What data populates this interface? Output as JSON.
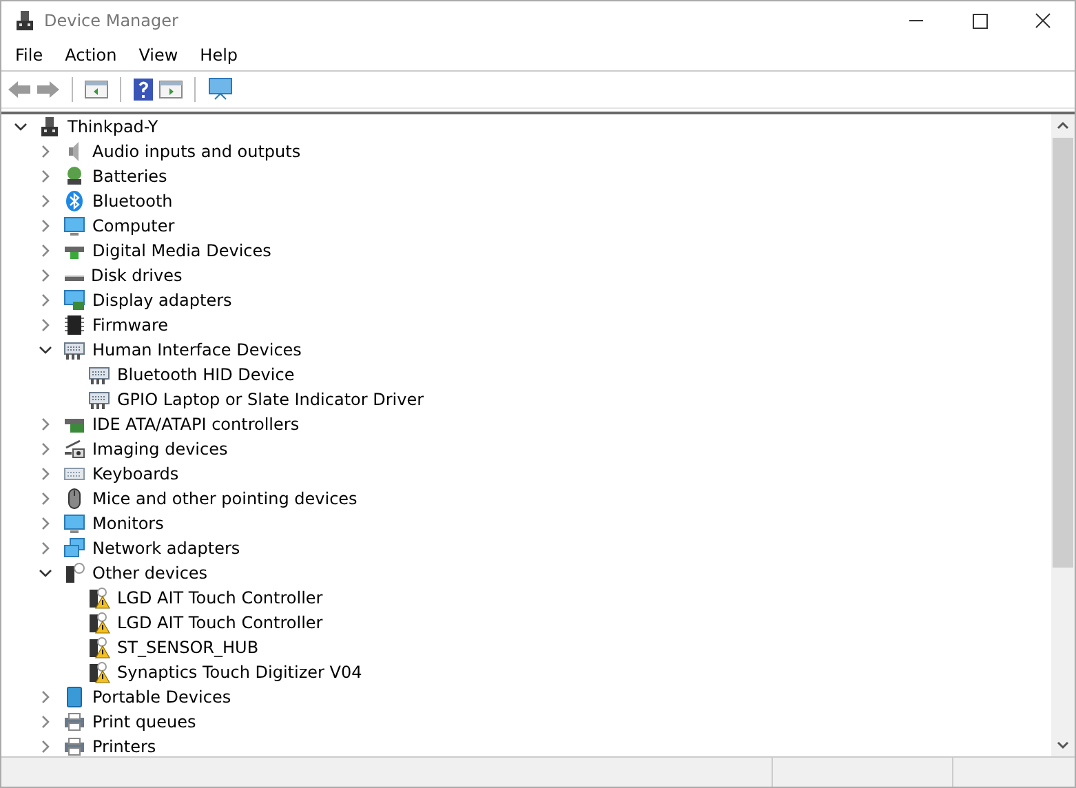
{
  "window": {
    "title": "Device Manager"
  },
  "menu": [
    "File",
    "Action",
    "View",
    "Help"
  ],
  "tree": {
    "label": "Thinkpad-Y",
    "expanded": true,
    "children": [
      {
        "label": "Audio inputs and outputs",
        "expanded": false
      },
      {
        "label": "Batteries",
        "expanded": false
      },
      {
        "label": "Bluetooth",
        "expanded": false
      },
      {
        "label": "Computer",
        "expanded": false
      },
      {
        "label": "Digital Media Devices",
        "expanded": false
      },
      {
        "label": "Disk drives",
        "expanded": false
      },
      {
        "label": "Display adapters",
        "expanded": false
      },
      {
        "label": "Firmware",
        "expanded": false
      },
      {
        "label": "Human Interface Devices",
        "expanded": true,
        "children": [
          {
            "label": "Bluetooth HID Device",
            "warning": false
          },
          {
            "label": "GPIO Laptop or Slate Indicator Driver",
            "warning": false
          }
        ]
      },
      {
        "label": "IDE ATA/ATAPI controllers",
        "expanded": false
      },
      {
        "label": "Imaging devices",
        "expanded": false
      },
      {
        "label": "Keyboards",
        "expanded": false
      },
      {
        "label": "Mice and other pointing devices",
        "expanded": false
      },
      {
        "label": "Monitors",
        "expanded": false
      },
      {
        "label": "Network adapters",
        "expanded": false
      },
      {
        "label": "Other devices",
        "expanded": true,
        "children": [
          {
            "label": "LGD AIT Touch Controller",
            "warning": true
          },
          {
            "label": "LGD AIT Touch Controller",
            "warning": true
          },
          {
            "label": "ST_SENSOR_HUB",
            "warning": true
          },
          {
            "label": "Synaptics Touch Digitizer V04",
            "warning": true
          }
        ]
      },
      {
        "label": "Portable Devices",
        "expanded": false
      },
      {
        "label": "Print queues",
        "expanded": false
      },
      {
        "label": "Printers",
        "expanded": false
      }
    ]
  }
}
